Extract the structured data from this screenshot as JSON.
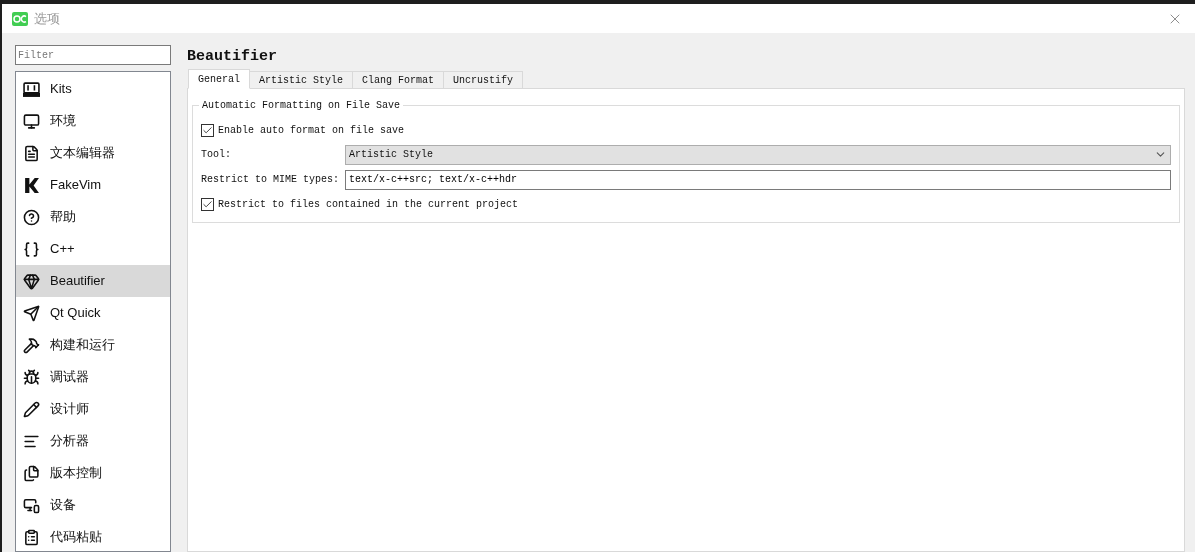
{
  "window": {
    "title": "选项"
  },
  "filter": {
    "placeholder": "Filter"
  },
  "sidebar": {
    "items": [
      {
        "label": "Kits",
        "selected": false
      },
      {
        "label": "环境",
        "selected": false
      },
      {
        "label": "文本编辑器",
        "selected": false
      },
      {
        "label": "FakeVim",
        "selected": false
      },
      {
        "label": "帮助",
        "selected": false
      },
      {
        "label": "C++",
        "selected": false
      },
      {
        "label": "Beautifier",
        "selected": true
      },
      {
        "label": "Qt Quick",
        "selected": false
      },
      {
        "label": "构建和运行",
        "selected": false
      },
      {
        "label": "调试器",
        "selected": false
      },
      {
        "label": "设计师",
        "selected": false
      },
      {
        "label": "分析器",
        "selected": false
      },
      {
        "label": "版本控制",
        "selected": false
      },
      {
        "label": "设备",
        "selected": false
      },
      {
        "label": "代码粘贴",
        "selected": false
      }
    ]
  },
  "page_title": "Beautifier",
  "tabs": [
    {
      "label": "General",
      "selected": true
    },
    {
      "label": "Artistic Style",
      "selected": false
    },
    {
      "label": "Clang Format",
      "selected": false
    },
    {
      "label": "Uncrustify",
      "selected": false
    }
  ],
  "group": {
    "title": "Automatic Formatting on File Save",
    "rows": [
      {
        "kind": "checkbox",
        "label": "Enable auto format on file save",
        "checked": true
      },
      {
        "kind": "select",
        "label": "Tool:",
        "value": "Artistic Style"
      },
      {
        "kind": "text",
        "label": "Restrict to MIME types:",
        "value": "text/x-c++src; text/x-c++hdr"
      },
      {
        "kind": "checkbox",
        "label": "Restrict to files contained in the current project",
        "checked": true
      }
    ]
  }
}
